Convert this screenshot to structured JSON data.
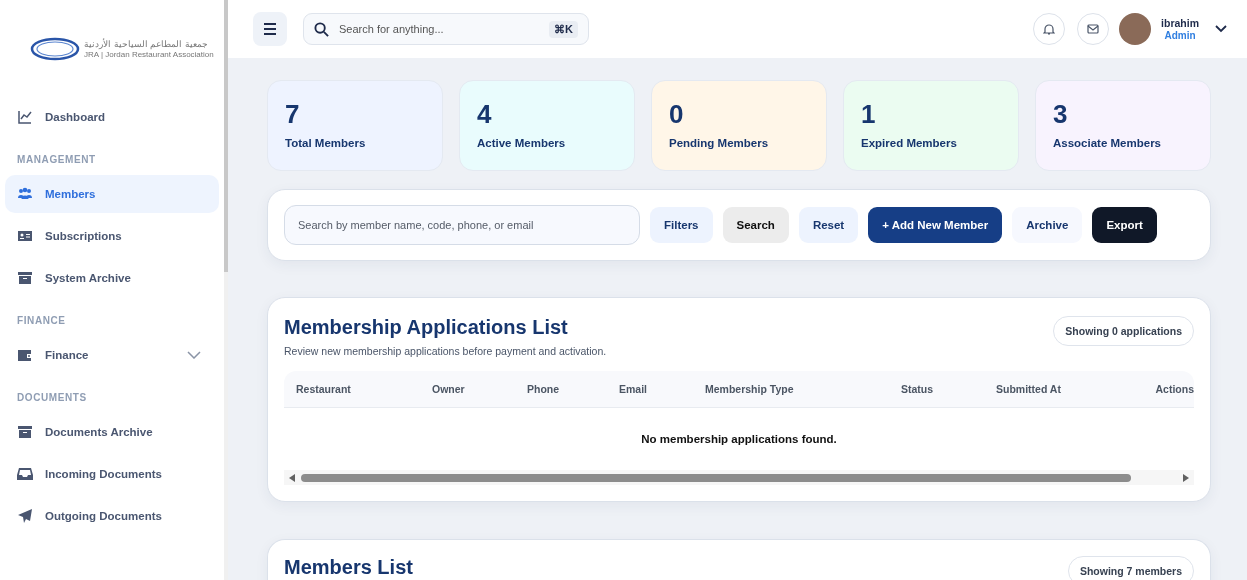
{
  "logo": {
    "arabic_name": "جمعية المطاعم السياحية الأردنية",
    "english_name": "JRA | Jordan Restaurant Association"
  },
  "sidebar": {
    "items": [
      {
        "kind": "link",
        "label": "Dashboard",
        "selected": false
      },
      {
        "kind": "heading",
        "label": "MANAGEMENT"
      },
      {
        "kind": "link",
        "label": "Members",
        "selected": true
      },
      {
        "kind": "link",
        "label": "Subscriptions",
        "selected": false
      },
      {
        "kind": "link",
        "label": "System Archive",
        "selected": false
      },
      {
        "kind": "heading",
        "label": "FINANCE"
      },
      {
        "kind": "group",
        "label": "Finance",
        "selected": false,
        "expanded": false
      },
      {
        "kind": "heading",
        "label": "DOCUMENTS"
      },
      {
        "kind": "link",
        "label": "Documents Archive",
        "selected": false
      },
      {
        "kind": "link",
        "label": "Incoming Documents",
        "selected": false
      },
      {
        "kind": "link",
        "label": "Outgoing Documents",
        "selected": false
      }
    ]
  },
  "topbar": {
    "search": {
      "placeholder": "Search for anything...",
      "shortcut": "⌘K"
    },
    "user": {
      "name": "ibrahim",
      "role": "Admin"
    }
  },
  "stats": [
    {
      "value": "7",
      "label": "Total Members",
      "color": "#eef3ff"
    },
    {
      "value": "4",
      "label": "Active Members",
      "color": "#e9fcfd"
    },
    {
      "value": "0",
      "label": "Pending Members",
      "color": "#fff6e8"
    },
    {
      "value": "1",
      "label": "Expired Members",
      "color": "#ebfcf1"
    },
    {
      "value": "3",
      "label": "Associate Members",
      "color": "#f8f3fe"
    }
  ],
  "filters": {
    "search": {
      "placeholder": "Search by member name, code, phone, or email"
    },
    "buttons": [
      {
        "label": "Filters",
        "kind": "soft"
      },
      {
        "label": "Search",
        "kind": "grey"
      },
      {
        "label": "Reset",
        "kind": "soft"
      },
      {
        "label": "+ Add New Member",
        "kind": "primary"
      },
      {
        "label": "Archive",
        "kind": "plain"
      },
      {
        "label": "Export",
        "kind": "dark"
      }
    ]
  },
  "applications": {
    "title": "Membership Applications List",
    "subtitle": "Review new membership applications before payment and activation.",
    "count": "Showing 0 applications",
    "columns": [
      "Restaurant",
      "Owner",
      "Phone",
      "Email",
      "Membership Type",
      "Status",
      "Submitted At",
      "Actions"
    ],
    "empty_message": "No membership applications found."
  },
  "members": {
    "title": "Members List",
    "count": "Showing 7 members"
  }
}
